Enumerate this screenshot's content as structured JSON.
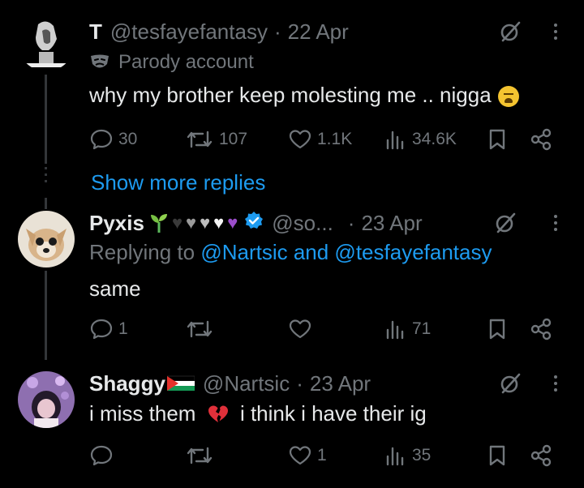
{
  "tweets": [
    {
      "name": "T",
      "handle": "@tesfayefantasy",
      "date": "22 Apr",
      "label": "Parody account",
      "text": "why my brother keep molesting me .. nigga",
      "replies": "30",
      "reposts": "107",
      "likes": "1.1K",
      "views": "34.6K"
    },
    {
      "show_more": "Show more replies"
    },
    {
      "name": "Pyxis",
      "handle": "@so...",
      "date": "23 Apr",
      "replying_prefix": "Replying to",
      "replying_users": "@Nartsic and @tesfayefantasy",
      "text": "same",
      "replies": "1",
      "reposts": "",
      "likes": "",
      "views": "71"
    },
    {
      "name": "Shaggy",
      "handle": "@Nartsic",
      "date": "23 Apr",
      "text_before": "i miss them",
      "text_after": "i think i have their ig",
      "replies": "",
      "reposts": "",
      "likes": "1",
      "views": "35"
    }
  ],
  "colors": {
    "background": "#000000",
    "text": "#e7e9ea",
    "muted": "#71767b",
    "link": "#1d9bf0",
    "thread_line": "#333639"
  }
}
